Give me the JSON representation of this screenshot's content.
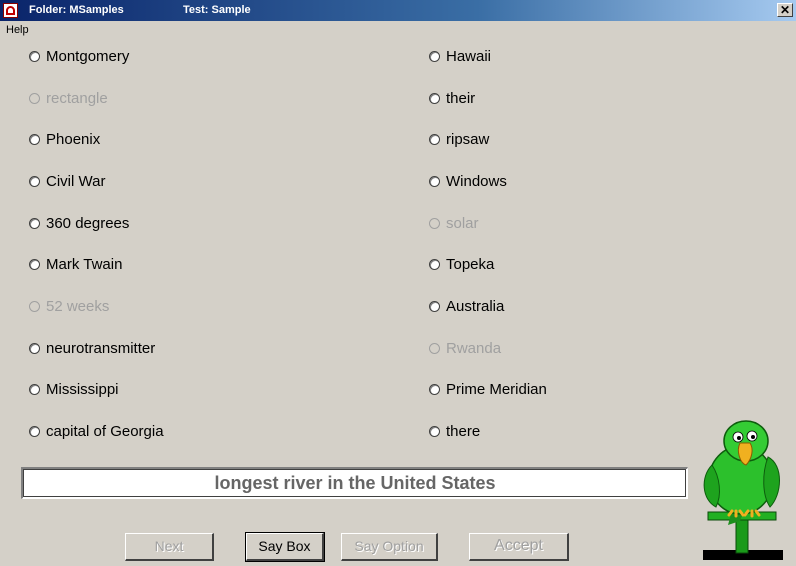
{
  "titlebar": {
    "folder": "Folder: MSamples",
    "test": "Test: Sample",
    "close_glyph": "✕"
  },
  "menu": {
    "help": "Help"
  },
  "options_left": [
    {
      "label": "Montgomery",
      "disabled": false
    },
    {
      "label": "rectangle",
      "disabled": true
    },
    {
      "label": "Phoenix",
      "disabled": false
    },
    {
      "label": "Civil War",
      "disabled": false
    },
    {
      "label": "360 degrees",
      "disabled": false
    },
    {
      "label": "Mark Twain",
      "disabled": false
    },
    {
      "label": "52 weeks",
      "disabled": true
    },
    {
      "label": "neurotransmitter",
      "disabled": false
    },
    {
      "label": "Mississippi",
      "disabled": false
    },
    {
      "label": "capital of Georgia",
      "disabled": false
    }
  ],
  "options_right": [
    {
      "label": "Hawaii",
      "disabled": false
    },
    {
      "label": "their",
      "disabled": false
    },
    {
      "label": "ripsaw",
      "disabled": false
    },
    {
      "label": "Windows",
      "disabled": false
    },
    {
      "label": "solar",
      "disabled": true
    },
    {
      "label": "Topeka",
      "disabled": false
    },
    {
      "label": "Australia",
      "disabled": false
    },
    {
      "label": "Rwanda",
      "disabled": true
    },
    {
      "label": "Prime Meridian",
      "disabled": false
    },
    {
      "label": "there",
      "disabled": false
    }
  ],
  "question": "longest river in the United States",
  "buttons": {
    "next": "Next",
    "say_box": "Say Box",
    "say_option": "Say Option",
    "accept": "Accept"
  },
  "mascot_icon": "parrot-icon"
}
